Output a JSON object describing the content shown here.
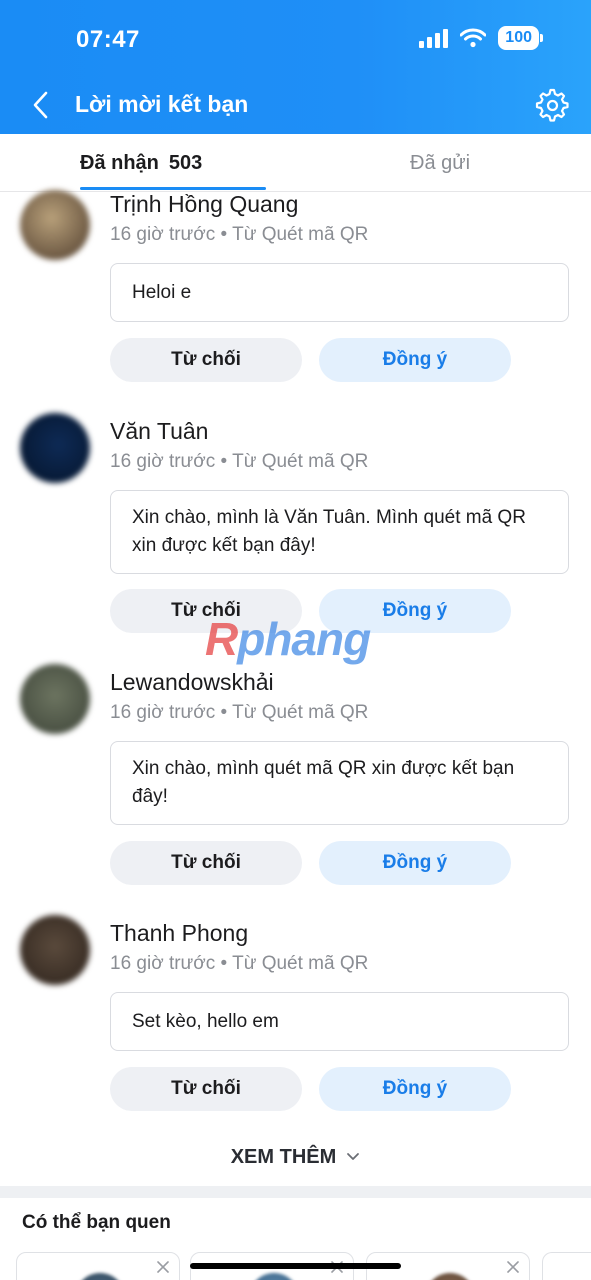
{
  "status_bar": {
    "time": "07:47",
    "battery": "100"
  },
  "header": {
    "title": "Lời mời kết bạn"
  },
  "tabs": {
    "received_label": "Đã nhận",
    "received_count": "503",
    "sent_label": "Đã gửi"
  },
  "requests": [
    {
      "name": "Trịnh Hồng Quang",
      "time": "16 giờ trước",
      "source": "Từ Quét mã QR",
      "message": "Heloi e",
      "decline": "Từ chối",
      "accept": "Đồng ý"
    },
    {
      "name": "Văn Tuân",
      "time": "16 giờ trước",
      "source": "Từ Quét mã QR",
      "message": "Xin chào, mình là Văn Tuân. Mình quét mã QR xin được kết bạn đây!",
      "decline": "Từ chối",
      "accept": "Đồng ý"
    },
    {
      "name": "Lewandowskhải",
      "time": "16 giờ trước",
      "source": "Từ Quét mã QR",
      "message": "Xin chào, mình quét mã QR xin được kết bạn đây!",
      "decline": "Từ chối",
      "accept": "Đồng ý"
    },
    {
      "name": "Thanh Phong",
      "time": "16 giờ trước",
      "source": "Từ Quét mã QR",
      "message": "Set kèo, hello em",
      "decline": "Từ chối",
      "accept": "Đồng ý"
    }
  ],
  "see_more": "XEM THÊM",
  "suggestions": {
    "title": "Có thể bạn quen"
  },
  "watermark": {
    "first": "R",
    "rest": "phang"
  },
  "colors": {
    "accent": "#1a8cf5",
    "accept_text": "#1a7de8",
    "muted": "#8a8d93"
  }
}
